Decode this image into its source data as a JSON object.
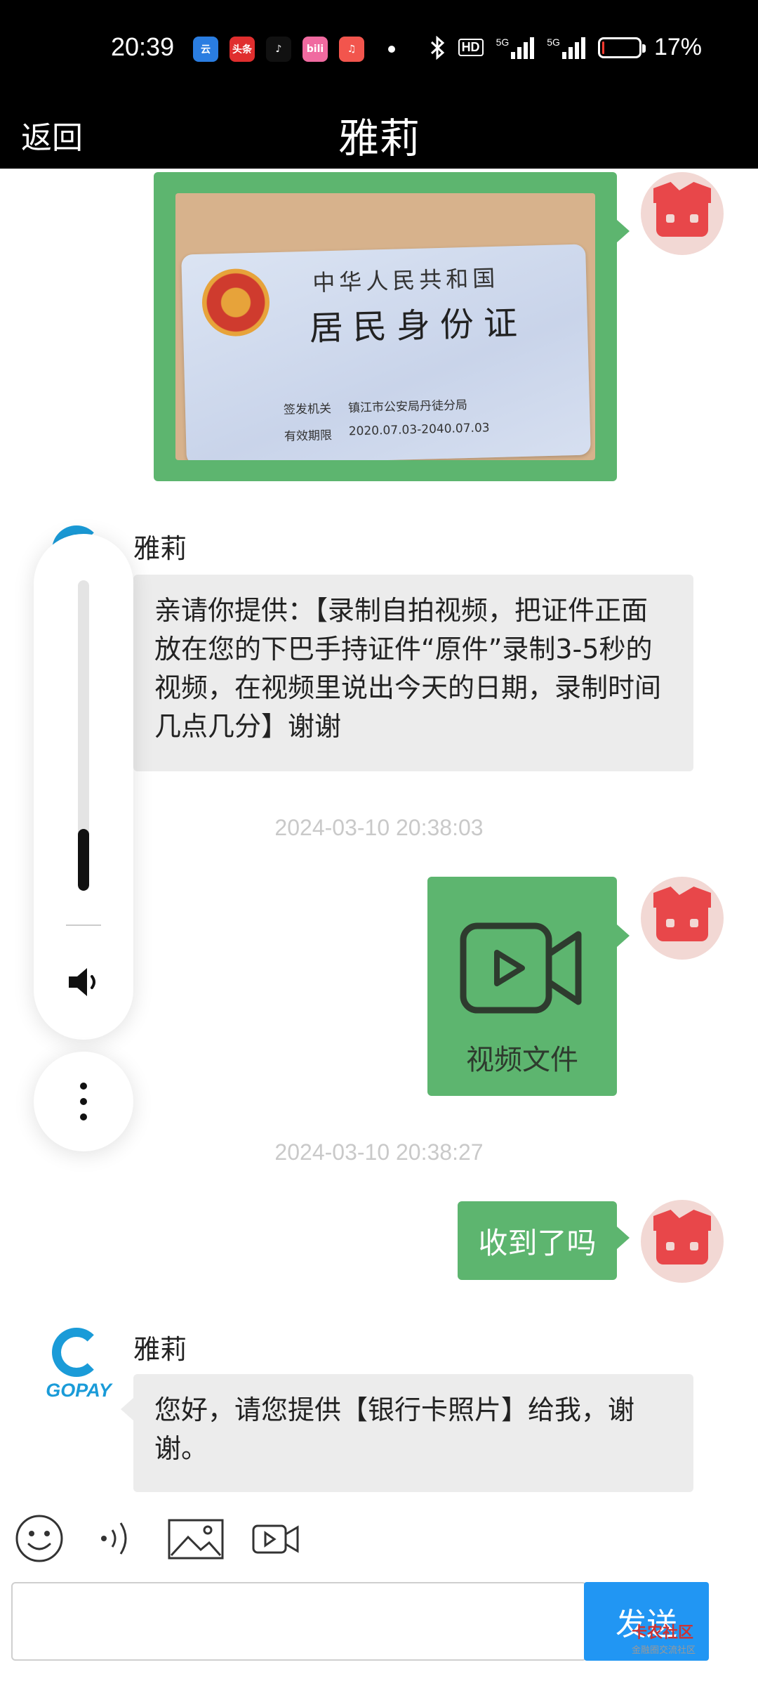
{
  "status_bar": {
    "time": "20:39",
    "apps": [
      {
        "label": "云",
        "color": "#2a7de1"
      },
      {
        "label": "头条",
        "color": "#e02e2e"
      },
      {
        "label": "♪",
        "color": "#111111"
      },
      {
        "label": "bili",
        "color": "#f06aa0"
      },
      {
        "label": "♫",
        "color": "#f2554d"
      }
    ],
    "hd_label": "HD",
    "network_1": "5G",
    "network_2": "5G",
    "battery_percent": "17%",
    "battery_level": 0.17
  },
  "header": {
    "back_label": "返回",
    "title": "雅莉"
  },
  "messages": {
    "id_card": {
      "line1": "中华人民共和国",
      "line2": "居民身份证",
      "issuer_label": "签发机关",
      "issuer_value": "镇江市公安局丹徒分局",
      "validity_label": "有效期限",
      "validity_value": "2020.07.03-2040.07.03"
    },
    "msg1_sender": "雅莉",
    "msg1_text": "亲请你提供：【录制自拍视频，把证件正面放在您的下巴手持证件“原件”录制3-5秒的视频，在视频里说出今天的日期，录制时间几点几分】谢谢",
    "timestamp1": "2024-03-10 20:38:03",
    "video_label": "视频文件",
    "timestamp2": "2024-03-10 20:38:27",
    "reply_text": "收到了吗",
    "msg2_sender": "雅莉",
    "gopay_label": "GOPAY",
    "msg2_text": "您好，请您提供【银行卡照片】给我，谢谢。"
  },
  "volume_panel": {
    "level": 0.2
  },
  "input_bar": {
    "placeholder": "",
    "send_label": "发送",
    "watermark": "卡农社区",
    "watermark_sub": "金融圈交流社区"
  },
  "icons": [
    "emoji-icon",
    "voice-icon",
    "image-icon",
    "video-icon",
    "speaker-icon",
    "more-vertical-icon"
  ],
  "colors": {
    "my_bubble": "#5db56f",
    "other_bubble": "#ececec",
    "send_button": "#2196f3",
    "header": "#000000"
  }
}
